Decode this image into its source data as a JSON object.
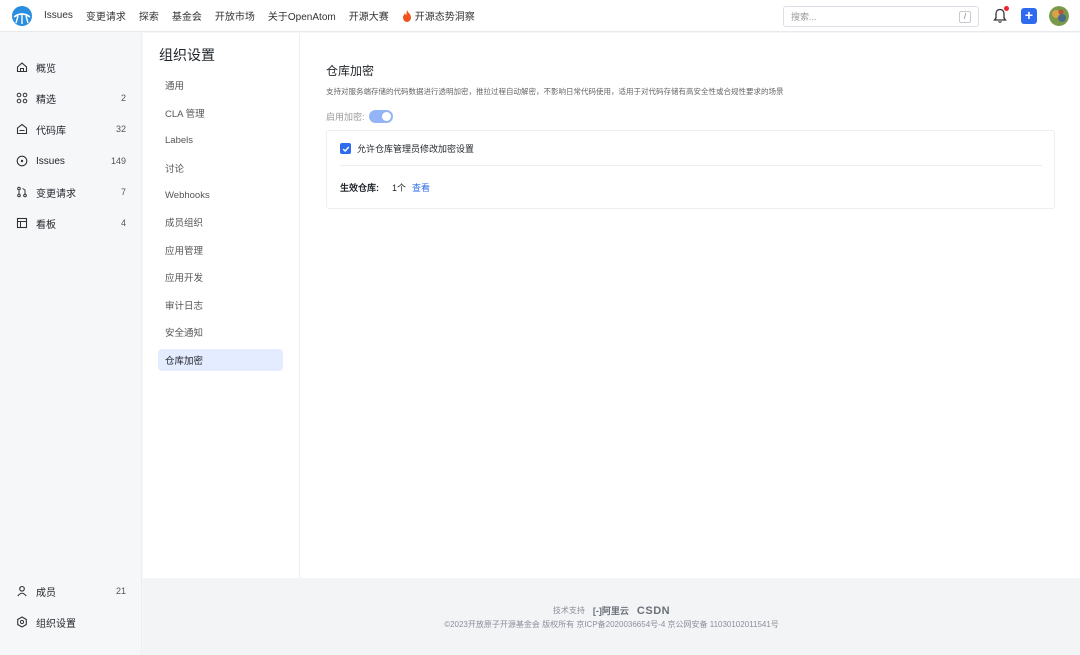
{
  "topbar": {
    "nav": [
      "Issues",
      "变更请求",
      "探索",
      "基金会",
      "开放市场",
      "关于OpenAtom",
      "开源大赛",
      "开源态势洞察"
    ],
    "search_placeholder": "搜索...",
    "search_shortcut": "/",
    "plus": "+"
  },
  "sidebar": {
    "items": [
      {
        "label": "概览",
        "count": "",
        "icon": "home-icon"
      },
      {
        "label": "精选",
        "count": "2",
        "icon": "grid-icon"
      },
      {
        "label": "代码库",
        "count": "32",
        "icon": "repo-icon"
      },
      {
        "label": "Issues",
        "count": "149",
        "icon": "issue-icon"
      },
      {
        "label": "变更请求",
        "count": "7",
        "icon": "pull-request-icon"
      },
      {
        "label": "看板",
        "count": "4",
        "icon": "board-icon"
      }
    ],
    "bottom": [
      {
        "label": "成员",
        "count": "21",
        "icon": "user-icon"
      },
      {
        "label": "组织设置",
        "count": "",
        "icon": "settings-icon"
      }
    ]
  },
  "settings": {
    "title": "组织设置",
    "items": [
      "通用",
      "CLA 管理",
      "Labels",
      "讨论",
      "Webhooks",
      "成员组织",
      "应用管理",
      "应用开发",
      "审计日志",
      "安全通知",
      "仓库加密"
    ],
    "active_index": 10
  },
  "main": {
    "title": "仓库加密",
    "description": "支持对服务端存储的代码数据进行透明加密，推拉过程自动解密，不影响日常代码使用，适用于对代码存储有高安全性或合规性要求的场景",
    "enable_label": "启用加密:",
    "enabled": true,
    "allow_admin_label": "允许仓库管理员修改加密设置",
    "allow_admin_checked": true,
    "effective_label": "生效仓库:",
    "effective_count": "1个",
    "view_link": "查看"
  },
  "footer": {
    "tech_support": "技术支持",
    "aliyun": "阿里云",
    "csdn": "CSDN",
    "copyright": "©2023开放原子开源基金会 版权所有  京ICP备2020036654号-4  京公网安备 11030102011541号"
  },
  "colors": {
    "accent": "#2f6bef",
    "active_bg": "#e4ecff",
    "toggle": "#93b5f7",
    "notify_dot": "#f5222d"
  }
}
